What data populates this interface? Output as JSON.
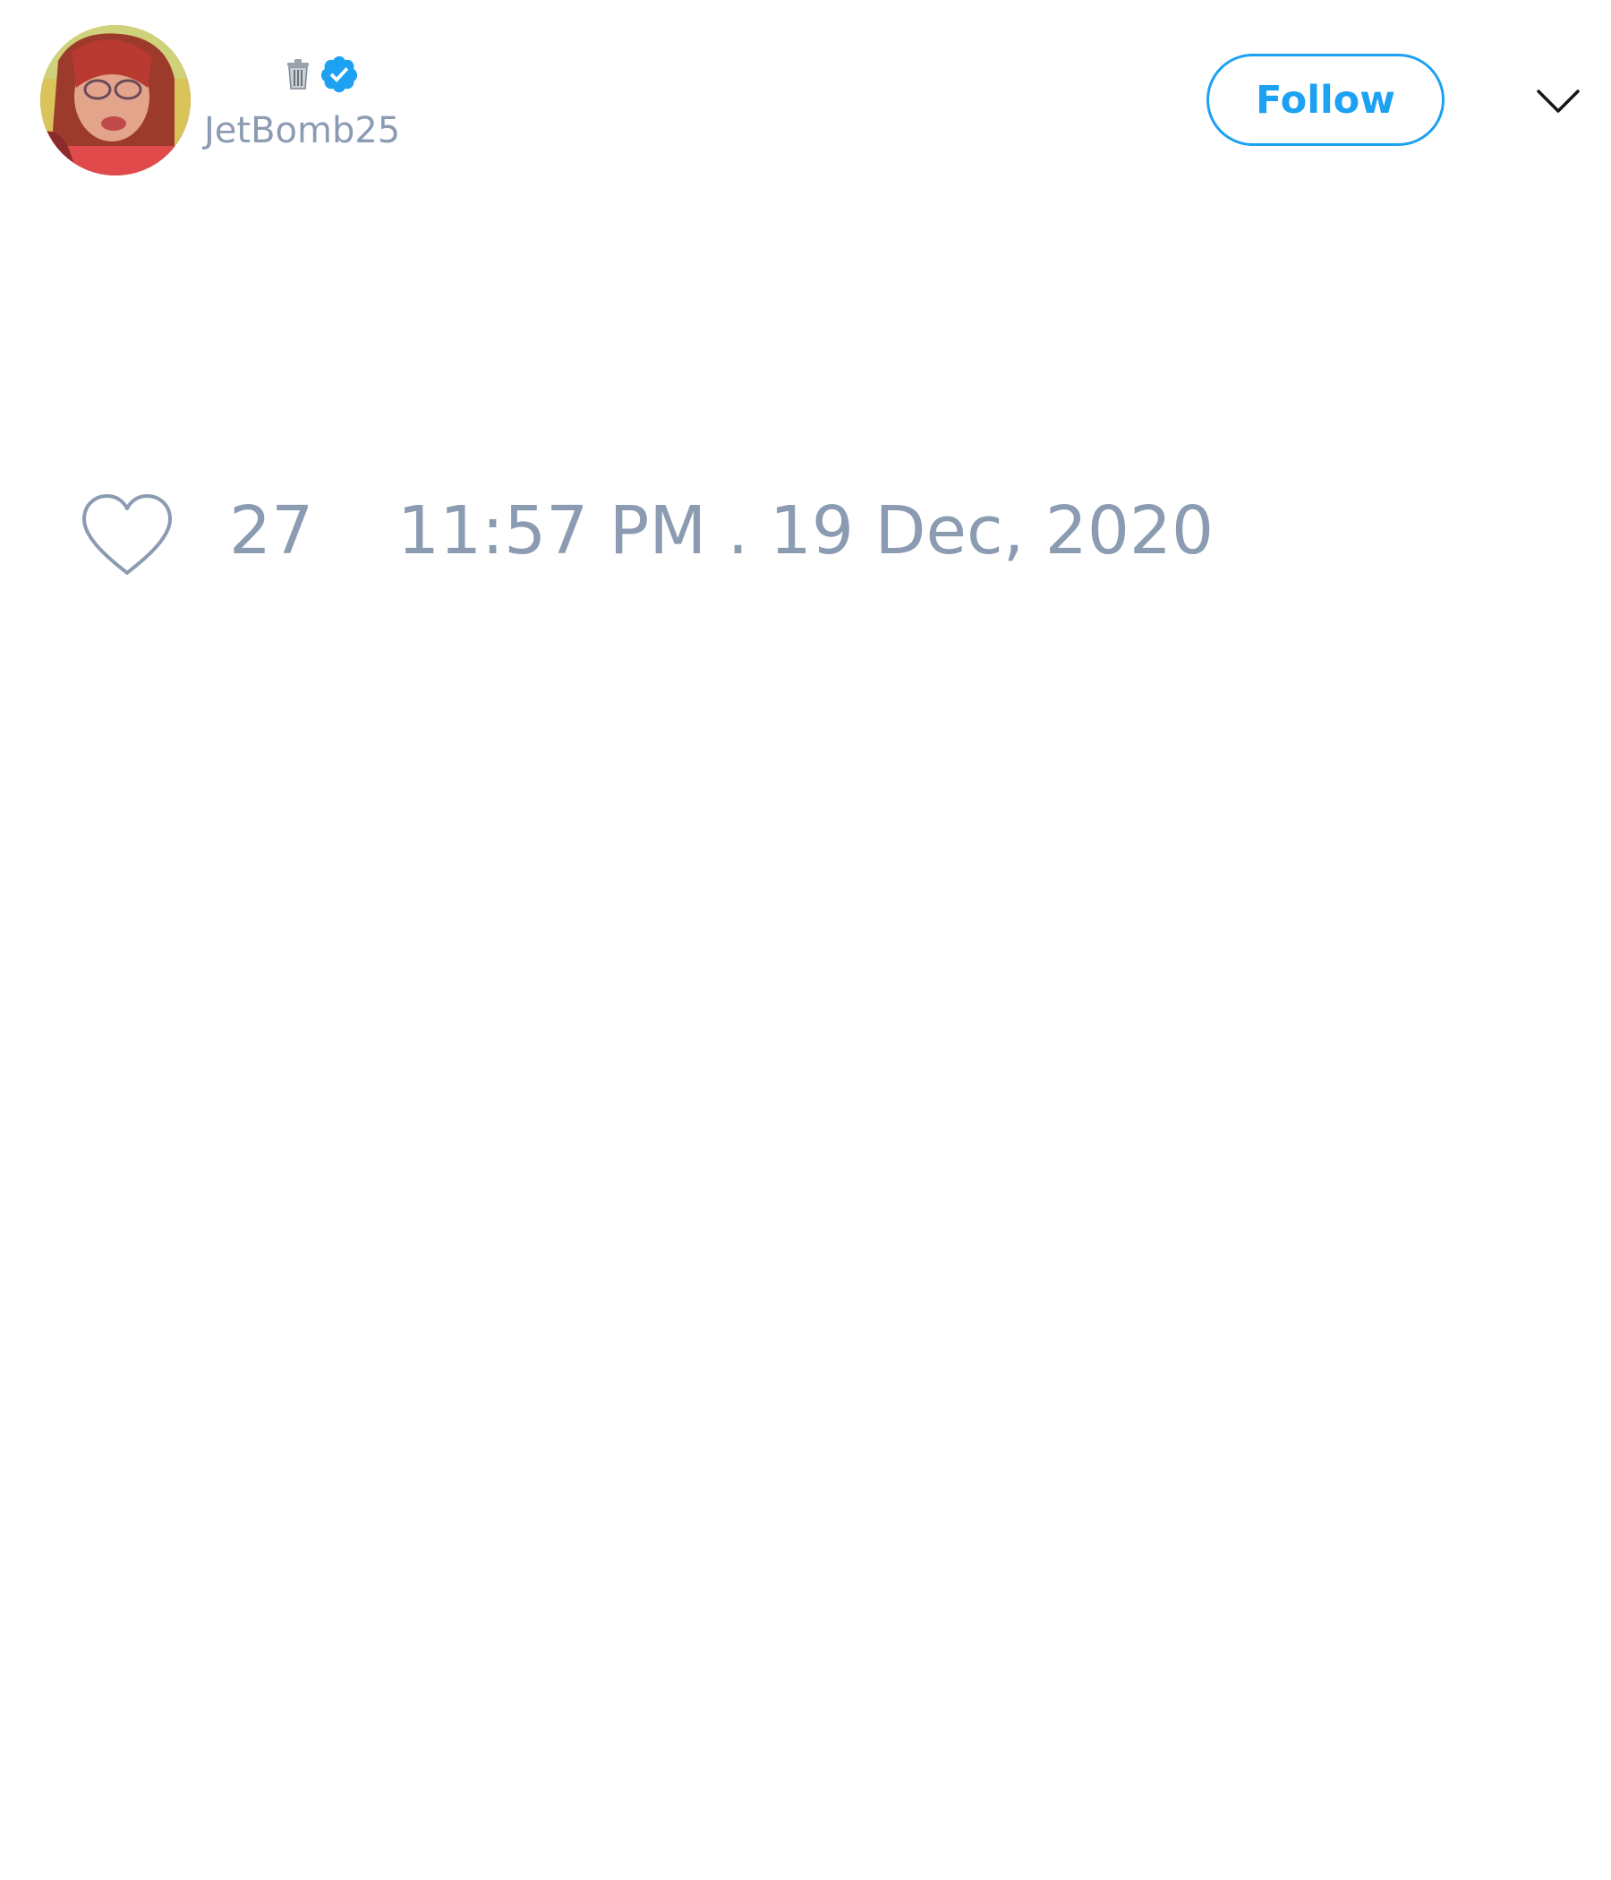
{
  "tweet": {
    "author": {
      "name_icon": "trash-icon",
      "verified_icon": "verified-icon",
      "handle": "JetBomb25",
      "avatar": "avatar"
    },
    "follow_label": "Follow",
    "menu_icon": "chevron-down-icon",
    "like_icon": "heart-icon",
    "like_count": "27",
    "timestamp": "11:57 PM . 19 Dec, 2020"
  },
  "colors": {
    "accent": "#1da1f2",
    "muted_text": "#8b9bb2",
    "background": "#ffffff"
  }
}
